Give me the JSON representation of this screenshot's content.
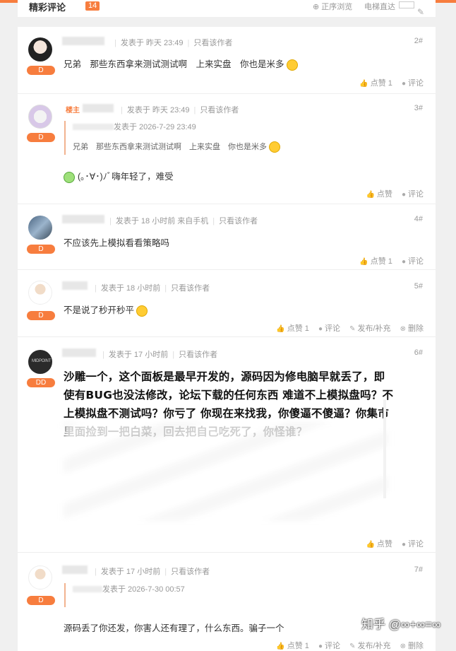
{
  "header": {
    "title": "精彩评论",
    "count": "14",
    "sort_label": "正序浏览",
    "floor_label": "电梯直达"
  },
  "posts": [
    {
      "floor": "2#",
      "level": "D",
      "time": "发表于 昨天 23:49",
      "only_author": "只看该作者",
      "content": "兄弟　那些东西拿来测试测试啊　上来实盘　你也是米多",
      "like": "点赞 1",
      "comment": "评论"
    },
    {
      "floor": "3#",
      "level": "D",
      "op_badge": "楼主",
      "time": "发表于 昨天 23:49",
      "only_author": "只看该作者",
      "quote_meta": "发表于 2026-7-29 23:49",
      "quote_text": "兄弟　那些东西拿来测试测试啊　上来实盘　你也是米多",
      "content": "(｡･∀･)ﾉﾞ嗨年轻了，难受",
      "like": "点赞",
      "comment": "评论"
    },
    {
      "floor": "4#",
      "level": "D",
      "time": "发表于 18 小时前 来自手机",
      "only_author": "只看该作者",
      "content": "不应该先上模拟看看策略吗",
      "like": "点赞 1",
      "comment": "评论"
    },
    {
      "floor": "5#",
      "level": "D",
      "time": "发表于 18 小时前",
      "only_author": "只看该作者",
      "content": "不是说了秒开秒平",
      "like": "点赞 1",
      "comment": "评论",
      "edit": "发布/补充",
      "delete": "删除"
    },
    {
      "floor": "6#",
      "level": "DD",
      "time": "发表于 17 小时前",
      "only_author": "只看该作者",
      "content": "沙雕一个，这个面板是最早开发的，源码因为修电脑早就丢了，即使有BUG也没法修改，论坛下载的任何东西 难道不上模拟盘吗？不上模拟盘不测试吗？你亏了 你现在来找我，你傻逼不傻逼？你集市里面捡到一把白菜，回去把自己吃死了，你怪谁？",
      "like": "点赞",
      "comment": "评论"
    },
    {
      "floor": "7#",
      "level": "D",
      "time": "发表于 17 小时前",
      "only_author": "只看该作者",
      "quote_meta": "发表于 2026-7-30 00:57",
      "content": "源码丢了你还发，你害人还有理了，什么东西。骗子一个",
      "like": "点赞 1",
      "comment": "评论",
      "edit": "发布/补充",
      "delete": "删除"
    }
  ],
  "watermark": "知乎 @∞+∞=∞",
  "colors": {
    "accent": "#f77d3e",
    "meta": "#999999",
    "background": "#f0f0f0"
  }
}
